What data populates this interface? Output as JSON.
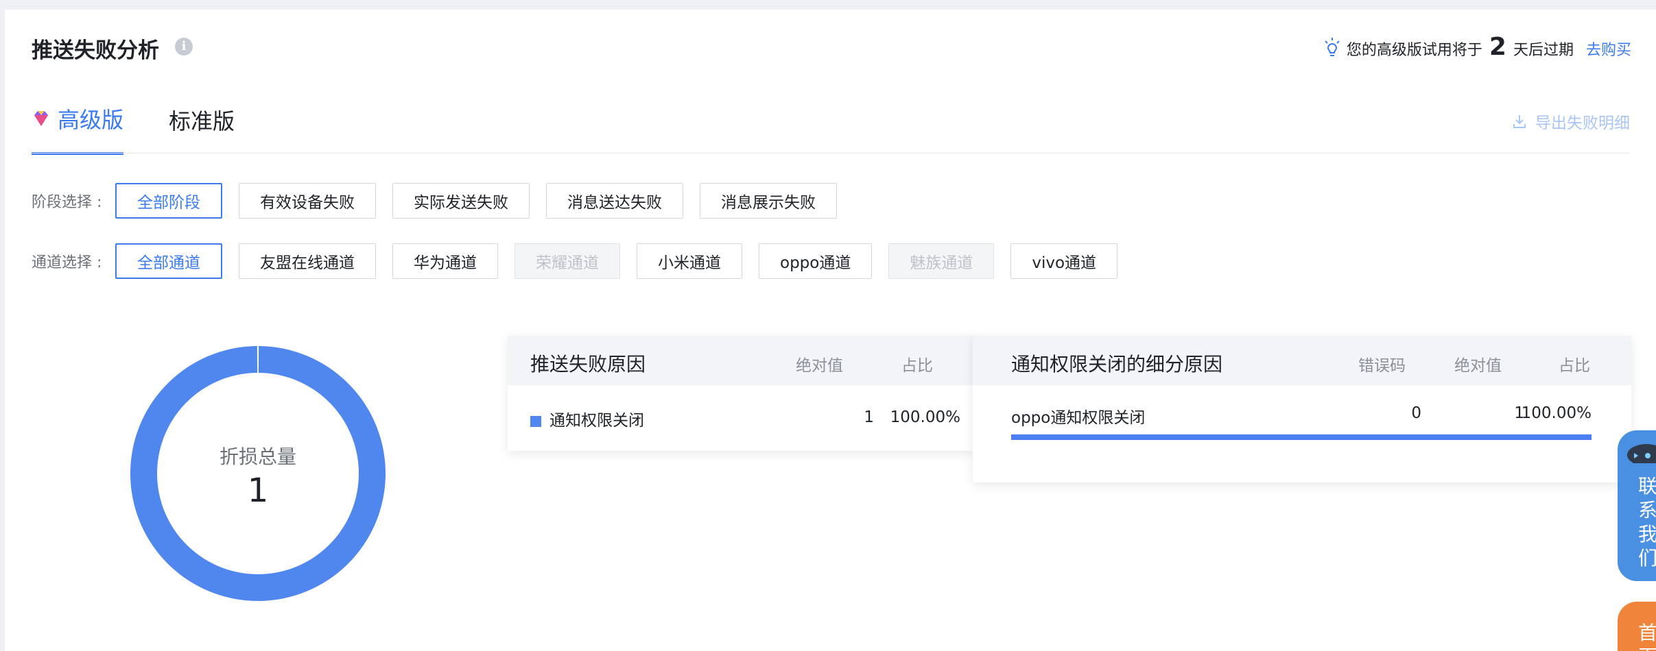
{
  "header": {
    "title": "推送失败分析",
    "trial_prefix": "您的高级版试用将于",
    "trial_days": "2",
    "trial_suffix": "天后过期",
    "buy_link": "去购买"
  },
  "tabs": [
    {
      "label": "高级版",
      "active": true
    },
    {
      "label": "标准版",
      "active": false
    }
  ],
  "export_label": "导出失败明细",
  "stage_filter": {
    "label": "阶段选择 :",
    "options": [
      {
        "label": "全部阶段",
        "state": "active"
      },
      {
        "label": "有效设备失败",
        "state": "normal"
      },
      {
        "label": "实际发送失败",
        "state": "normal"
      },
      {
        "label": "消息送达失败",
        "state": "normal"
      },
      {
        "label": "消息展示失败",
        "state": "normal"
      }
    ]
  },
  "channel_filter": {
    "label": "通道选择 :",
    "options": [
      {
        "label": "全部通道",
        "state": "active"
      },
      {
        "label": "友盟在线通道",
        "state": "normal"
      },
      {
        "label": "华为通道",
        "state": "normal"
      },
      {
        "label": "荣耀通道",
        "state": "disabled"
      },
      {
        "label": "小米通道",
        "state": "normal"
      },
      {
        "label": "oppo通道",
        "state": "normal"
      },
      {
        "label": "魅族通道",
        "state": "disabled"
      },
      {
        "label": "vivo通道",
        "state": "normal"
      }
    ]
  },
  "donut": {
    "label": "折损总量",
    "value": "1",
    "segments": [
      {
        "name": "通知权限关闭",
        "fraction": 1.0,
        "color": "#4f87ee"
      }
    ]
  },
  "reason_table": {
    "title": "推送失败原因",
    "col_abs": "绝对值",
    "col_pct": "占比",
    "rows": [
      {
        "reason": "通知权限关闭",
        "abs": "1",
        "pct": "100.00%"
      }
    ]
  },
  "detail_table": {
    "title": "通知权限关闭的细分原因",
    "col_code": "错误码",
    "col_abs": "绝对值",
    "col_pct": "占比",
    "rows": [
      {
        "reason": "oppo通知权限关闭",
        "code": "0",
        "abs": "1",
        "pct": "100.00%",
        "fraction": 1.0
      }
    ]
  },
  "side": {
    "contact_label": "联系我们",
    "home_label": "首页"
  },
  "colors": {
    "accent": "#3a7bf0",
    "donut": "#4f87ee",
    "contact": "#4a90e2",
    "home": "#f0843a"
  }
}
